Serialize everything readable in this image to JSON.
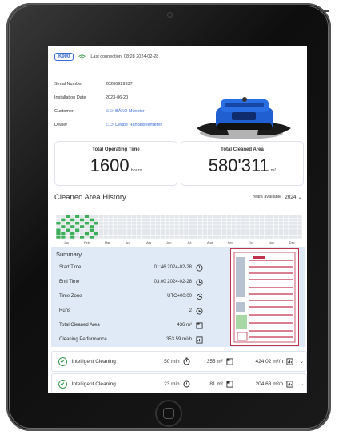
{
  "header": {
    "model": "K900",
    "last_connection": "Last connection: 08:28 2024-02-28"
  },
  "info": {
    "serial_label": "Serial Number",
    "serial_value": "20200929337",
    "install_label": "Installation Date",
    "install_value": "2023-06-20",
    "customer_label": "Customer",
    "customer_value": "BÄKO Münster",
    "dealer_label": "Dealer",
    "dealer_value": "Deltbe Handelsvertreter"
  },
  "cards": {
    "operating_title": "Total Operating Time",
    "operating_value": "1600",
    "operating_unit": "hours",
    "area_title": "Total Cleaned Area",
    "area_value": "580'311",
    "area_unit": "m²"
  },
  "history": {
    "title": "Cleaned Area History",
    "years_label": "Years available",
    "year_selected": "2024",
    "months": [
      "Jan",
      "Feb",
      "Mar",
      "Apr",
      "May",
      "Jun",
      "Jul",
      "Aug",
      "Sep",
      "Oct",
      "Nov",
      "Dec"
    ],
    "active_weeks": [
      [
        0,
        2
      ],
      [
        0,
        4
      ],
      [
        0,
        5
      ],
      [
        0,
        6
      ],
      [
        1,
        1
      ],
      [
        1,
        3
      ],
      [
        1,
        5
      ],
      [
        1,
        6
      ],
      [
        2,
        0
      ],
      [
        2,
        2
      ],
      [
        2,
        4
      ],
      [
        3,
        1
      ],
      [
        3,
        3
      ],
      [
        3,
        5
      ],
      [
        3,
        6
      ],
      [
        4,
        0
      ],
      [
        4,
        2
      ],
      [
        4,
        4
      ],
      [
        5,
        1
      ],
      [
        5,
        3
      ],
      [
        5,
        6
      ],
      [
        6,
        0
      ],
      [
        6,
        2
      ],
      [
        6,
        5
      ],
      [
        7,
        1
      ],
      [
        7,
        3
      ],
      [
        7,
        4
      ],
      [
        7,
        6
      ],
      [
        8,
        2
      ],
      [
        8,
        5
      ]
    ]
  },
  "colors": {
    "accent": "#3b6fd6",
    "heat_active": "#3fae5a",
    "heat_inactive": "#e3e6ea",
    "summary_bg": "#dfeaf6",
    "map_border": "#c0334d",
    "check": "#3d9b4e"
  },
  "summary": {
    "title": "Summary",
    "rows": [
      {
        "label": "Start Time",
        "value": "01:46 2024-02-28",
        "icon": "clock-icon"
      },
      {
        "label": "End Time",
        "value": "03:00 2024-02-28",
        "icon": "clock-icon"
      },
      {
        "label": "Time Zone",
        "value": "UTC+00:00",
        "icon": "timezone-icon"
      },
      {
        "label": "Runs",
        "value": "2",
        "icon": "play-icon"
      },
      {
        "label": "Total Cleaned Area",
        "value": "436 m²",
        "icon": "area-icon"
      },
      {
        "label": "Cleaning Performance",
        "value": "353.59 m²/h",
        "icon": "performance-icon"
      }
    ]
  },
  "jobs": [
    {
      "name": "Intelligent Cleaning",
      "duration": "50 min",
      "area": "355 m²",
      "performance": "424.02 m²/h"
    },
    {
      "name": "Intelligent Cleaning",
      "duration": "23 min",
      "area": "81 m²",
      "performance": "204.63 m²/h"
    }
  ]
}
